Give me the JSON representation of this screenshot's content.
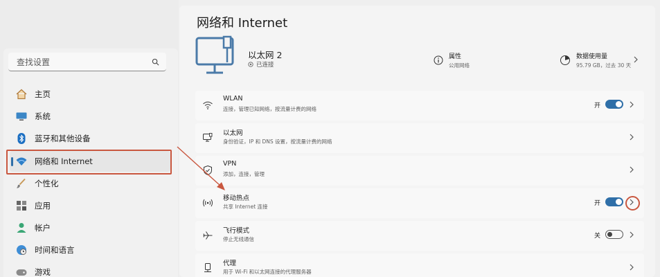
{
  "sidebar": {
    "search": {
      "placeholder": "查找设置"
    },
    "items": [
      {
        "label": "主页",
        "icon": "home-icon"
      },
      {
        "label": "系统",
        "icon": "monitor-icon"
      },
      {
        "label": "蓝牙和其他设备",
        "icon": "bluetooth-icon"
      },
      {
        "label": "网络和 Internet",
        "icon": "wifi-icon",
        "active": true
      },
      {
        "label": "个性化",
        "icon": "brush-icon"
      },
      {
        "label": "应用",
        "icon": "apps-icon"
      },
      {
        "label": "帐户",
        "icon": "person-icon"
      },
      {
        "label": "时间和语言",
        "icon": "globe-clock-icon"
      },
      {
        "label": "游戏",
        "icon": "gamepad-icon"
      }
    ]
  },
  "main": {
    "title": "网络和 Internet",
    "hero": {
      "name": "以太网 2",
      "status": "已连接",
      "properties": {
        "title": "属性",
        "sub": "公用网络"
      },
      "usage": {
        "title": "数据使用量",
        "sub": "95.79 GB，过去 30 天"
      }
    },
    "rows": [
      {
        "title": "WLAN",
        "desc": "连接，管理已知网络，按流量计费的网络",
        "toggle": "on",
        "toggle_label": "开",
        "icon": "wifi-icon"
      },
      {
        "title": "以太网",
        "desc": "身份验证，IP 和 DNS 设置，按流量计费的网络",
        "icon": "ethernet-icon"
      },
      {
        "title": "VPN",
        "desc": "添加，连接，管理",
        "icon": "shield-icon"
      },
      {
        "title": "移动热点",
        "desc": "共享 Internet 连接",
        "toggle": "on",
        "toggle_label": "开",
        "icon": "hotspot-icon"
      },
      {
        "title": "飞行模式",
        "desc": "停止无线通信",
        "toggle": "off",
        "toggle_label": "关",
        "icon": "airplane-icon"
      },
      {
        "title": "代理",
        "desc": "用于 Wi-Fi 和以太网连接的代理服务器",
        "icon": "proxy-icon"
      }
    ]
  },
  "colors": {
    "accent": "#2f6fa8",
    "annotation": "#c9573f"
  }
}
